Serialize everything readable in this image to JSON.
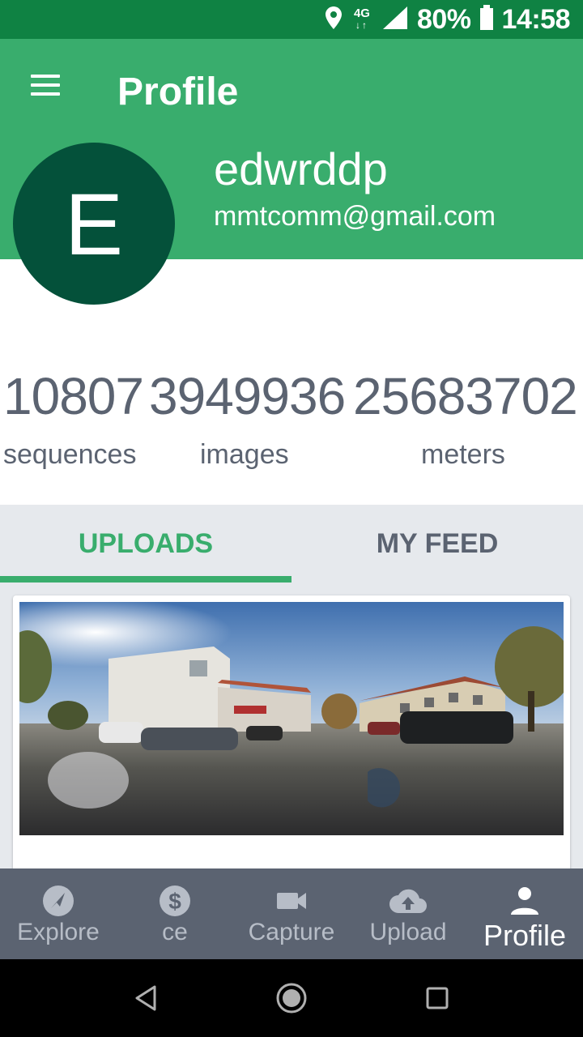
{
  "status_bar": {
    "network": "4G",
    "battery": "80%",
    "time": "14:58"
  },
  "header": {
    "title": "Profile",
    "username": "edwrddp",
    "email": "mmtcomm@gmail.com",
    "avatar_letter": "E"
  },
  "stats": [
    {
      "value": "10807",
      "label": "sequences"
    },
    {
      "value": "3949936",
      "label": "images"
    },
    {
      "value": "25683702",
      "label": "meters"
    }
  ],
  "tabs": [
    {
      "label": "UPLOADS",
      "active": true
    },
    {
      "label": "MY FEED",
      "active": false
    }
  ],
  "bottom_nav": [
    {
      "label": "Explore",
      "icon": "compass-icon"
    },
    {
      "label": "ce",
      "icon": "dollar-icon"
    },
    {
      "label": "Capture",
      "icon": "video-camera-icon"
    },
    {
      "label": "Upload",
      "icon": "cloud-upload-icon"
    },
    {
      "label": "Profile",
      "icon": "person-icon",
      "active": true
    }
  ],
  "colors": {
    "status_bar": "#0f8243",
    "header": "#39ad6d",
    "avatar": "#04513a",
    "text_gray": "#5b6371",
    "nav_bg": "#5b6371"
  }
}
